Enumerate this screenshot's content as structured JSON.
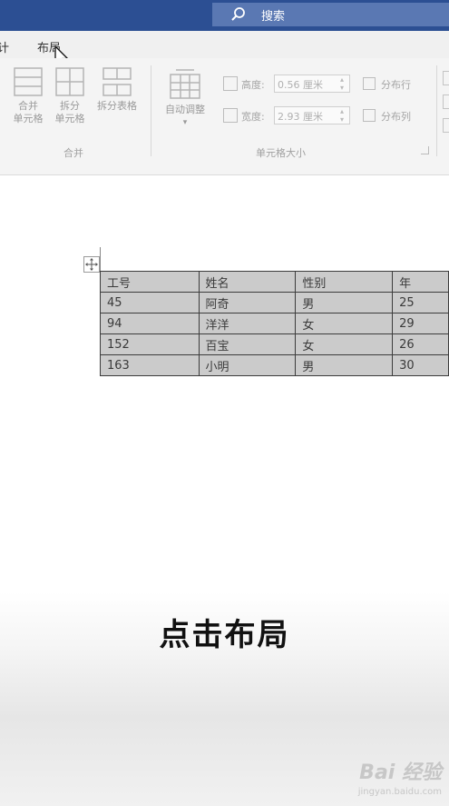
{
  "search": {
    "label": "搜索"
  },
  "tabs": [
    {
      "label": "计"
    },
    {
      "label": "布局"
    }
  ],
  "ribbon": {
    "merge_cells": "合并\n单元格",
    "split_cells": "拆分\n单元格",
    "split_table": "拆分表格",
    "merge_group": "合并",
    "autofit": "自动调整",
    "height_label": "高度:",
    "height_value": "0.56 厘米",
    "width_label": "宽度:",
    "width_value": "2.93 厘米",
    "distribute_rows": "分布行",
    "distribute_cols": "分布列",
    "cell_size_group": "单元格大小"
  },
  "table": {
    "headers": [
      "工号",
      "姓名",
      "性别",
      "年"
    ],
    "rows": [
      [
        "45",
        "阿奇",
        "男",
        "25"
      ],
      [
        "94",
        "洋洋",
        "女",
        "29"
      ],
      [
        "152",
        "百宝",
        "女",
        "26"
      ],
      [
        "163",
        "小明",
        "男",
        "30"
      ]
    ]
  },
  "caption": "点击布局",
  "watermark": {
    "brand": "Bai 经验",
    "url": "jingyan.baidu.com"
  },
  "colors": {
    "titlebar": "#2c4f93",
    "search": "#5a78b3",
    "cell_fill": "#cbcbcb"
  }
}
